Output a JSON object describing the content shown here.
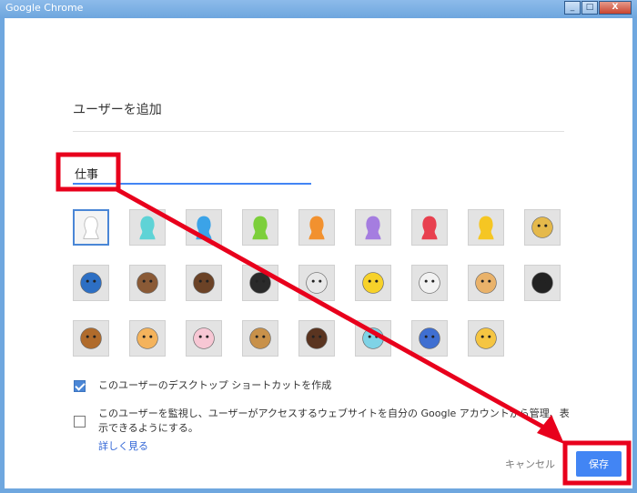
{
  "window": {
    "title": "Google Chrome",
    "controls": {
      "minimize": "_",
      "maximize": "□",
      "close": "X"
    }
  },
  "dialog": {
    "heading": "ユーザーを追加",
    "name_value": "仕事",
    "avatars": [
      {
        "name": "white-silhouette",
        "color": "#ffffff"
      },
      {
        "name": "cyan-silhouette",
        "color": "#5fd3d6"
      },
      {
        "name": "blue-silhouette",
        "color": "#3ba3e8"
      },
      {
        "name": "green-silhouette",
        "color": "#7ccf3b"
      },
      {
        "name": "orange-silhouette",
        "color": "#f2912f"
      },
      {
        "name": "purple-silhouette",
        "color": "#a57de0"
      },
      {
        "name": "red-silhouette",
        "color": "#e8404f"
      },
      {
        "name": "yellow-silhouette",
        "color": "#f5c623"
      },
      {
        "name": "blonde-person",
        "color": "#e5b94b"
      },
      {
        "name": "superhero",
        "color": "#2d6fc4"
      },
      {
        "name": "woman-with-mask",
        "color": "#8a5a36"
      },
      {
        "name": "man-portrait",
        "color": "#6b4226"
      },
      {
        "name": "ninja",
        "color": "#2a2a2a"
      },
      {
        "name": "alien",
        "color": "#e8e8e8"
      },
      {
        "name": "smiley",
        "color": "#f7d22a"
      },
      {
        "name": "flower",
        "color": "#f2f2f2"
      },
      {
        "name": "pizza",
        "color": "#e9b26a"
      },
      {
        "name": "soccer-ball",
        "color": "#222222"
      },
      {
        "name": "hamburger",
        "color": "#b06b2b"
      },
      {
        "name": "cat",
        "color": "#f4b35c"
      },
      {
        "name": "cupcake",
        "color": "#f7c7d4"
      },
      {
        "name": "dog",
        "color": "#c8914a"
      },
      {
        "name": "horse",
        "color": "#5a3420"
      },
      {
        "name": "cocktail",
        "color": "#7fd3e6"
      },
      {
        "name": "music-note",
        "color": "#3f6fd1"
      },
      {
        "name": "sun-cloud",
        "color": "#f5c542"
      }
    ],
    "option_shortcut": {
      "label": "このユーザーのデスクトップ ショートカットを作成",
      "checked": true
    },
    "option_supervise": {
      "label_line1": "このユーザーを監視し、ユーザーがアクセスするウェブサイトを自分の Google アカウントから管理、表",
      "label_line2": "示できるようにする。",
      "checked": false
    },
    "learn_more": "詳しく見る",
    "cancel_label": "キャンセル",
    "save_label": "保存"
  },
  "annotation": {
    "color": "#e8001c"
  }
}
